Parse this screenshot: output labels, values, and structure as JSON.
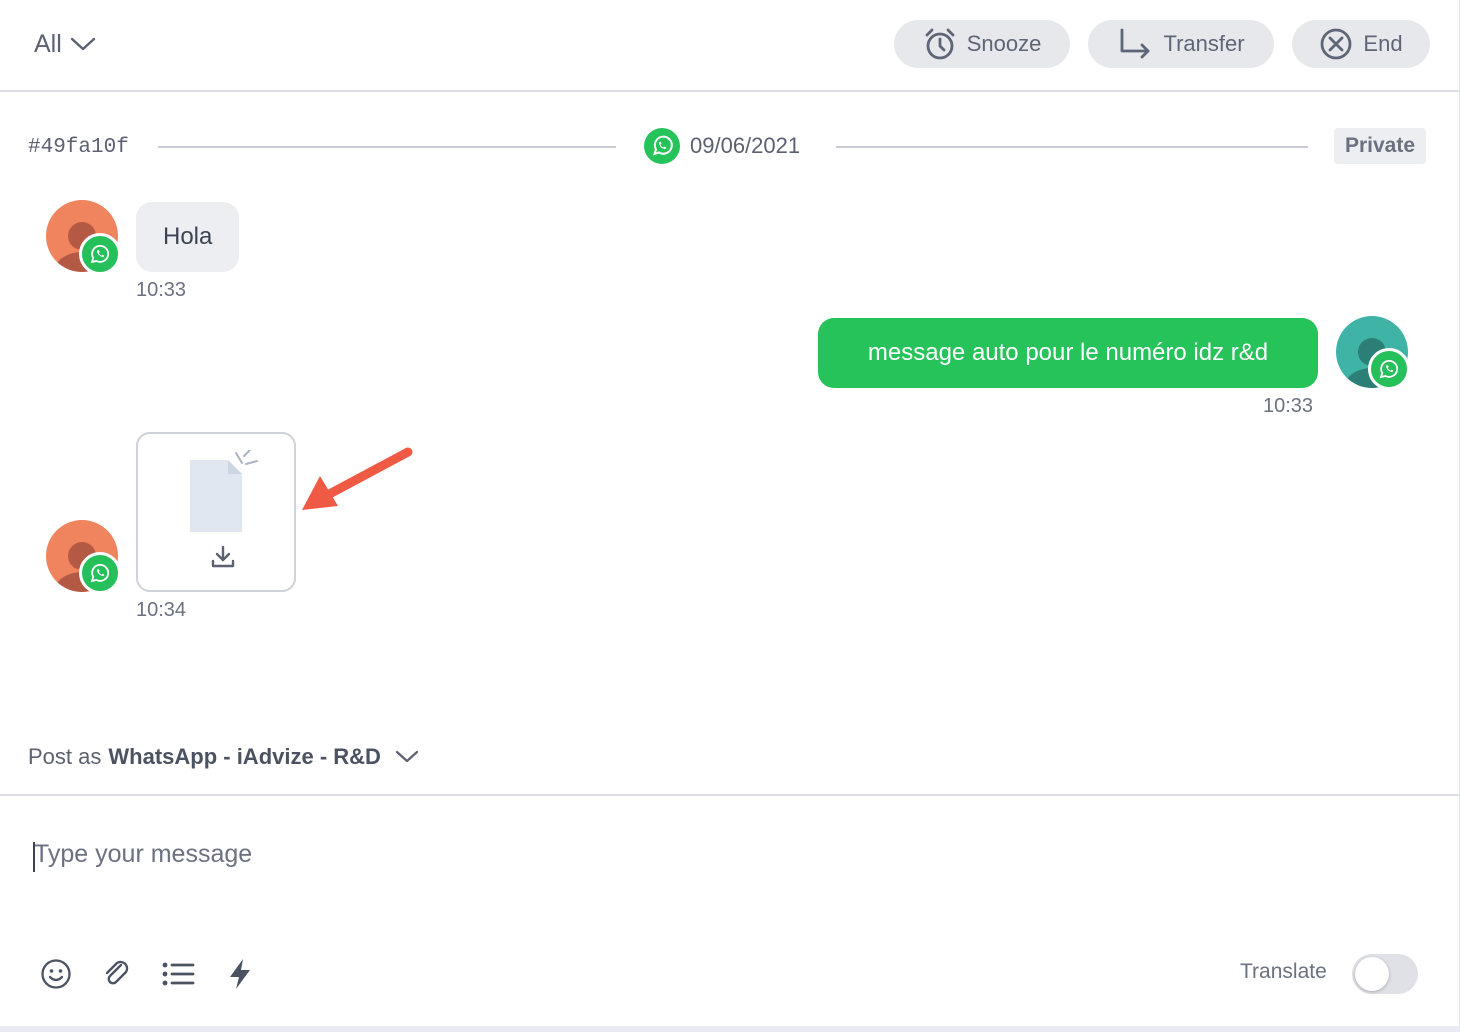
{
  "header": {
    "filter_label": "All",
    "snooze_label": "Snooze",
    "transfer_label": "Transfer",
    "end_label": "End"
  },
  "conversation": {
    "id": "#49fa10f",
    "date": "09/06/2021",
    "channel_icon": "whatsapp-icon",
    "visibility": "Private"
  },
  "messages": [
    {
      "direction": "incoming",
      "type": "text",
      "text": "Hola",
      "time": "10:33"
    },
    {
      "direction": "outgoing",
      "type": "text",
      "text": "message auto pour le numéro idz r&d",
      "time": "10:33"
    },
    {
      "direction": "incoming",
      "type": "file",
      "icon": "document-icon",
      "action_icon": "download-icon",
      "time": "10:34"
    }
  ],
  "post_as": {
    "prefix": "Post as",
    "sender": "WhatsApp - iAdvize - R&D"
  },
  "composer": {
    "placeholder": "Type your message"
  },
  "toolbar": {
    "icons": [
      "emoji-icon",
      "attachment-icon",
      "list-icon",
      "lightning-icon"
    ],
    "translate_label": "Translate",
    "translate_enabled": false
  },
  "colors": {
    "whatsapp_green": "#25c35a",
    "incoming_bubble": "#eceef2",
    "button_bg": "#e6e8ec",
    "annotation_arrow": "#ef5a44"
  }
}
